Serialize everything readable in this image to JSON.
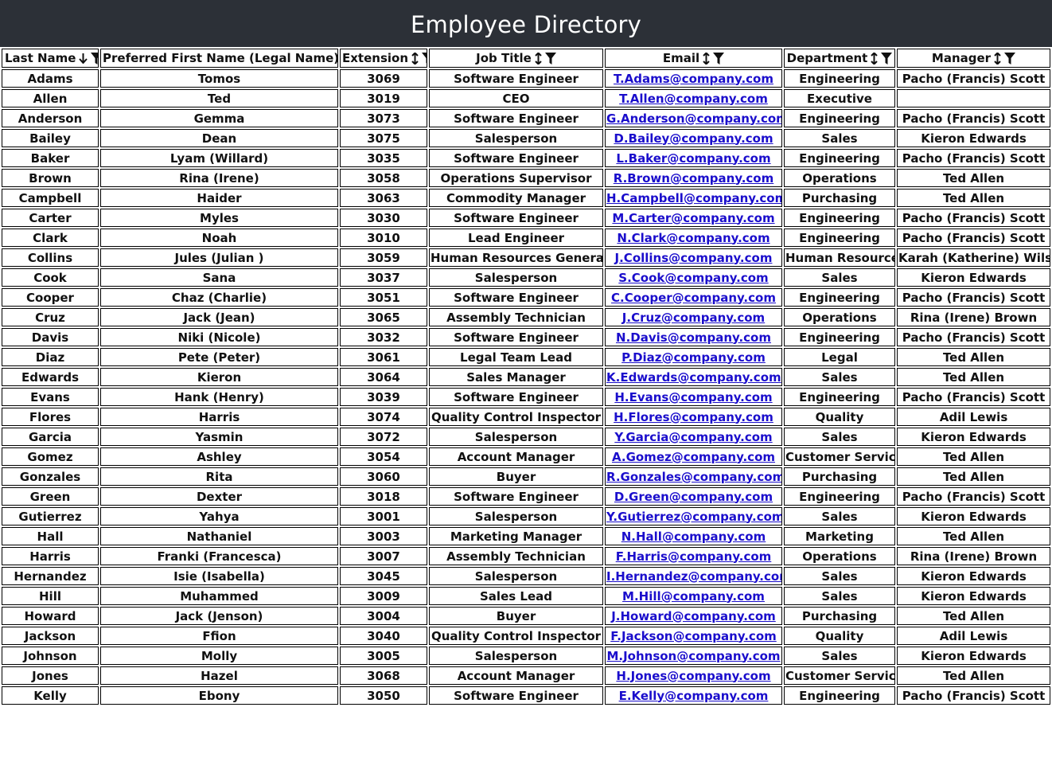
{
  "header": {
    "title": "Employee Directory"
  },
  "columns": {
    "last_name": "Last Name",
    "preferred_first_name": "Preferred First Name (Legal Name)",
    "extension": "Extension",
    "job_title": "Job Title",
    "email": "Email",
    "department": "Department",
    "manager": "Manager"
  },
  "icons": {
    "last_name_sort": "arrow-down-icon",
    "other_sort": "sort-updown-icon",
    "filter": "filter-funnel-icon"
  },
  "rows": [
    {
      "last": "Adams",
      "first": "Tomos",
      "ext": "3069",
      "job": "Software Engineer",
      "email": "T.Adams@company.com",
      "dept": "Engineering",
      "mgr": "Pacho (Francis) Scott"
    },
    {
      "last": "Allen",
      "first": "Ted",
      "ext": "3019",
      "job": "CEO",
      "email": "T.Allen@company.com",
      "dept": "Executive",
      "mgr": ""
    },
    {
      "last": "Anderson",
      "first": "Gemma",
      "ext": "3073",
      "job": "Software Engineer",
      "email": "G.Anderson@company.com",
      "dept": "Engineering",
      "mgr": "Pacho (Francis) Scott"
    },
    {
      "last": "Bailey",
      "first": "Dean",
      "ext": "3075",
      "job": "Salesperson",
      "email": "D.Bailey@company.com",
      "dept": "Sales",
      "mgr": "Kieron Edwards"
    },
    {
      "last": "Baker",
      "first": "Lyam (Willard)",
      "ext": "3035",
      "job": "Software Engineer",
      "email": "L.Baker@company.com",
      "dept": "Engineering",
      "mgr": "Pacho (Francis) Scott"
    },
    {
      "last": "Brown",
      "first": "Rina (Irene)",
      "ext": "3058",
      "job": "Operations Supervisor",
      "email": "R.Brown@company.com",
      "dept": "Operations",
      "mgr": "Ted Allen"
    },
    {
      "last": "Campbell",
      "first": "Haider",
      "ext": "3063",
      "job": "Commodity Manager",
      "email": "H.Campbell@company.com",
      "dept": "Purchasing",
      "mgr": "Ted Allen"
    },
    {
      "last": "Carter",
      "first": "Myles",
      "ext": "3030",
      "job": "Software Engineer",
      "email": "M.Carter@company.com",
      "dept": "Engineering",
      "mgr": "Pacho (Francis) Scott"
    },
    {
      "last": "Clark",
      "first": "Noah",
      "ext": "3010",
      "job": "Lead Engineer",
      "email": "N.Clark@company.com",
      "dept": "Engineering",
      "mgr": "Pacho (Francis) Scott"
    },
    {
      "last": "Collins",
      "first": "Jules (Julian )",
      "ext": "3059",
      "job": "Human Resources Generalist",
      "email": "J.Collins@company.com",
      "dept": "Human Resources",
      "mgr": "Karah (Katherine) Wilson"
    },
    {
      "last": "Cook",
      "first": "Sana",
      "ext": "3037",
      "job": "Salesperson",
      "email": "S.Cook@company.com",
      "dept": "Sales",
      "mgr": "Kieron Edwards"
    },
    {
      "last": "Cooper",
      "first": "Chaz (Charlie)",
      "ext": "3051",
      "job": "Software Engineer",
      "email": "C.Cooper@company.com",
      "dept": "Engineering",
      "mgr": "Pacho (Francis) Scott"
    },
    {
      "last": "Cruz",
      "first": "Jack (Jean)",
      "ext": "3065",
      "job": "Assembly Technician",
      "email": "J.Cruz@company.com",
      "dept": "Operations",
      "mgr": "Rina (Irene) Brown"
    },
    {
      "last": "Davis",
      "first": "Niki (Nicole)",
      "ext": "3032",
      "job": "Software Engineer",
      "email": "N.Davis@company.com",
      "dept": "Engineering",
      "mgr": "Pacho (Francis) Scott"
    },
    {
      "last": "Diaz",
      "first": "Pete (Peter)",
      "ext": "3061",
      "job": "Legal Team Lead",
      "email": "P.Diaz@company.com",
      "dept": "Legal",
      "mgr": "Ted Allen"
    },
    {
      "last": "Edwards",
      "first": "Kieron",
      "ext": "3064",
      "job": "Sales Manager",
      "email": "K.Edwards@company.com",
      "dept": "Sales",
      "mgr": "Ted Allen"
    },
    {
      "last": "Evans",
      "first": "Hank (Henry)",
      "ext": "3039",
      "job": "Software Engineer",
      "email": "H.Evans@company.com",
      "dept": "Engineering",
      "mgr": "Pacho (Francis) Scott"
    },
    {
      "last": "Flores",
      "first": "Harris",
      "ext": "3074",
      "job": "Quality Control Inspector",
      "email": "H.Flores@company.com",
      "dept": "Quality",
      "mgr": "Adil Lewis"
    },
    {
      "last": "Garcia",
      "first": "Yasmin",
      "ext": "3072",
      "job": "Salesperson",
      "email": "Y.Garcia@company.com",
      "dept": "Sales",
      "mgr": "Kieron Edwards"
    },
    {
      "last": "Gomez",
      "first": "Ashley",
      "ext": "3054",
      "job": "Account Manager",
      "email": "A.Gomez@company.com",
      "dept": "Customer Service",
      "mgr": "Ted Allen"
    },
    {
      "last": "Gonzales",
      "first": "Rita",
      "ext": "3060",
      "job": "Buyer",
      "email": "R.Gonzales@company.com",
      "dept": "Purchasing",
      "mgr": "Ted Allen"
    },
    {
      "last": "Green",
      "first": "Dexter",
      "ext": "3018",
      "job": "Software Engineer",
      "email": "D.Green@company.com",
      "dept": "Engineering",
      "mgr": "Pacho (Francis) Scott"
    },
    {
      "last": "Gutierrez",
      "first": "Yahya",
      "ext": "3001",
      "job": "Salesperson",
      "email": "Y.Gutierrez@company.com",
      "dept": "Sales",
      "mgr": "Kieron Edwards"
    },
    {
      "last": "Hall",
      "first": "Nathaniel",
      "ext": "3003",
      "job": "Marketing Manager",
      "email": "N.Hall@company.com",
      "dept": "Marketing",
      "mgr": "Ted Allen"
    },
    {
      "last": "Harris",
      "first": "Franki (Francesca)",
      "ext": "3007",
      "job": "Assembly Technician",
      "email": "F.Harris@company.com",
      "dept": "Operations",
      "mgr": "Rina (Irene) Brown"
    },
    {
      "last": "Hernandez",
      "first": "Isie (Isabella)",
      "ext": "3045",
      "job": "Salesperson",
      "email": "I.Hernandez@company.com",
      "dept": "Sales",
      "mgr": "Kieron Edwards"
    },
    {
      "last": "Hill",
      "first": "Muhammed",
      "ext": "3009",
      "job": "Sales Lead",
      "email": "M.Hill@company.com",
      "dept": "Sales",
      "mgr": "Kieron Edwards"
    },
    {
      "last": "Howard",
      "first": "Jack (Jenson)",
      "ext": "3004",
      "job": "Buyer",
      "email": "J.Howard@company.com",
      "dept": "Purchasing",
      "mgr": "Ted Allen"
    },
    {
      "last": "Jackson",
      "first": "Ffion",
      "ext": "3040",
      "job": "Quality Control Inspector",
      "email": "F.Jackson@company.com",
      "dept": "Quality",
      "mgr": "Adil Lewis"
    },
    {
      "last": "Johnson",
      "first": "Molly",
      "ext": "3005",
      "job": "Salesperson",
      "email": "M.Johnson@company.com",
      "dept": "Sales",
      "mgr": "Kieron Edwards"
    },
    {
      "last": "Jones",
      "first": "Hazel",
      "ext": "3068",
      "job": "Account Manager",
      "email": "H.Jones@company.com",
      "dept": "Customer Service",
      "mgr": "Ted Allen"
    },
    {
      "last": "Kelly",
      "first": "Ebony",
      "ext": "3050",
      "job": "Software Engineer",
      "email": "E.Kelly@company.com",
      "dept": "Engineering",
      "mgr": "Pacho (Francis) Scott"
    }
  ]
}
